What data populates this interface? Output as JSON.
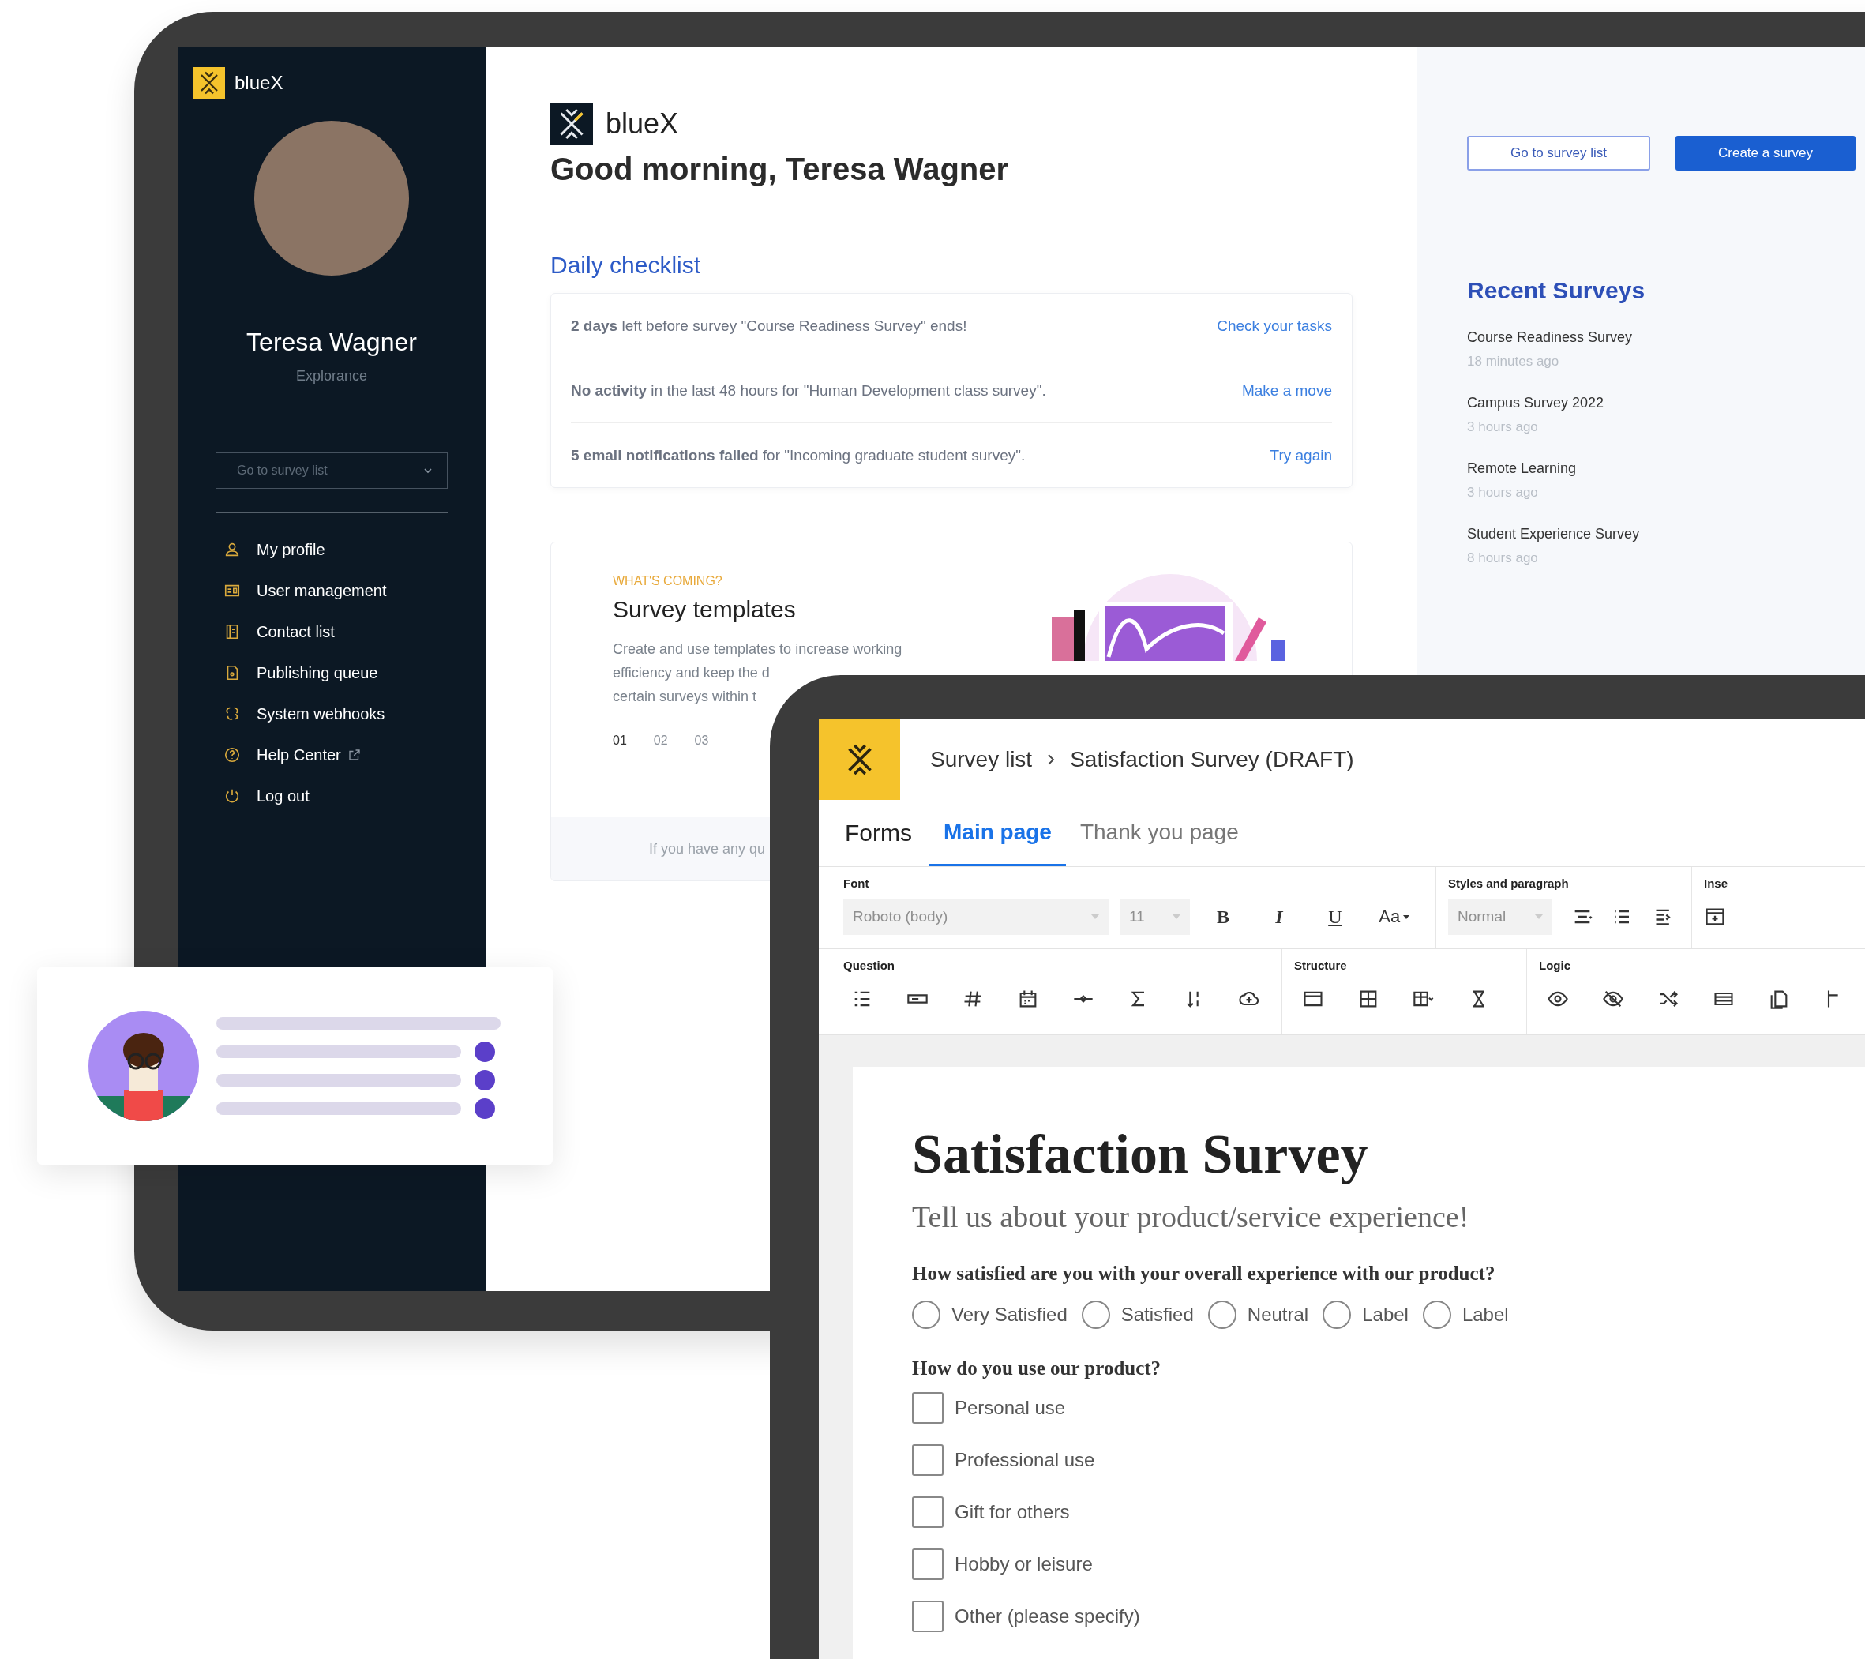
{
  "sidebar": {
    "logo_text": "blueX",
    "user_name": "Teresa Wagner",
    "organization": "Explorance",
    "survey_dropdown": {
      "placeholder": "Go to survey list"
    },
    "menu": [
      {
        "label": "My profile",
        "external": false
      },
      {
        "label": "User management",
        "external": false
      },
      {
        "label": "Contact list",
        "external": false
      },
      {
        "label": "Publishing queue",
        "external": false
      },
      {
        "label": "System webhooks",
        "external": false
      },
      {
        "label": "Help Center",
        "external": true
      },
      {
        "label": "Log out",
        "external": false
      }
    ]
  },
  "dashboard": {
    "logo_text": "blueX",
    "greeting": "Good morning, Teresa Wagner",
    "checklist": {
      "title": "Daily checklist",
      "items": [
        {
          "text": "**2 days** left before survey \"Course Readiness Survey\" ends!",
          "action": "Check your tasks"
        },
        {
          "text": "**No activity** in the last 48 hours for \"Human Development class survey\".",
          "action": "Make a move"
        },
        {
          "text": "**5 email notifications failed** for \"Incoming graduate student survey\".",
          "action": "Try again"
        }
      ]
    },
    "whats_coming": {
      "eyebrow": "WHAT'S COMING?",
      "title": "Survey templates",
      "description_lines": [
        "Create and use templates to increase working",
        "efficiency and keep the d",
        "certain surveys within t"
      ],
      "pages": [
        {
          "label": "01",
          "selected": true
        },
        {
          "label": "02",
          "selected": false
        },
        {
          "label": "03",
          "selected": false
        }
      ],
      "footer": "If you have any qu"
    }
  },
  "side_panel": {
    "buttons": [
      {
        "label": "Go to survey list",
        "kind": "secondary"
      },
      {
        "label": "Create a survey",
        "kind": "primary"
      }
    ],
    "recent_title": "Recent Surveys",
    "recent": [
      {
        "name": "Course Readiness Survey",
        "time": "18 minutes ago"
      },
      {
        "name": "Campus Survey 2022",
        "time": "3 hours ago"
      },
      {
        "name": "Remote Learning",
        "time": "3 hours ago"
      },
      {
        "name": "Student Experience Survey",
        "time": "8 hours ago"
      }
    ]
  },
  "editor": {
    "breadcrumb": [
      "Survey list",
      "Satisfaction Survey (DRAFT)"
    ],
    "section_title": "Forms",
    "tabs": [
      {
        "label": "Main page",
        "selected": true
      },
      {
        "label": "Thank you page",
        "selected": false
      }
    ],
    "ribbon": {
      "font_label": "Font",
      "font_family": {
        "value": "Roboto (body)",
        "disabled": true
      },
      "font_size": {
        "value": "11",
        "disabled": true
      },
      "format_buttons": [
        {
          "label": "B",
          "kind": "bold"
        },
        {
          "label": "I",
          "kind": "italic"
        },
        {
          "label": "U",
          "kind": "underline"
        },
        {
          "label": "Aa",
          "kind": "case"
        }
      ],
      "styles_label": "Styles and paragraph",
      "paragraph_style": {
        "value": "Normal",
        "disabled": true
      },
      "insert_label": "Inse",
      "question_label": "Question",
      "structure_label": "Structure",
      "logic_label": "Logic"
    },
    "form": {
      "title": "Satisfaction Survey",
      "subtitle": "Tell us about your product/service experience!",
      "questions": [
        {
          "kind": "radio",
          "text": "How satisfied are you with your overall experience with our product?",
          "options": [
            {
              "label": "Very Satisfied",
              "selected": false
            },
            {
              "label": "Satisfied",
              "selected": false
            },
            {
              "label": "Neutral",
              "selected": false
            },
            {
              "label": "Label",
              "selected": false
            },
            {
              "label": "Label",
              "selected": false
            }
          ]
        },
        {
          "kind": "checkbox",
          "text": "How do you use our product?",
          "options": [
            {
              "label": "Personal use",
              "checked": false
            },
            {
              "label": "Professional use",
              "checked": false
            },
            {
              "label": "Gift for others",
              "checked": false
            },
            {
              "label": "Hobby or leisure",
              "checked": false
            },
            {
              "label": "Other (please specify)",
              "checked": false
            }
          ]
        }
      ]
    }
  }
}
